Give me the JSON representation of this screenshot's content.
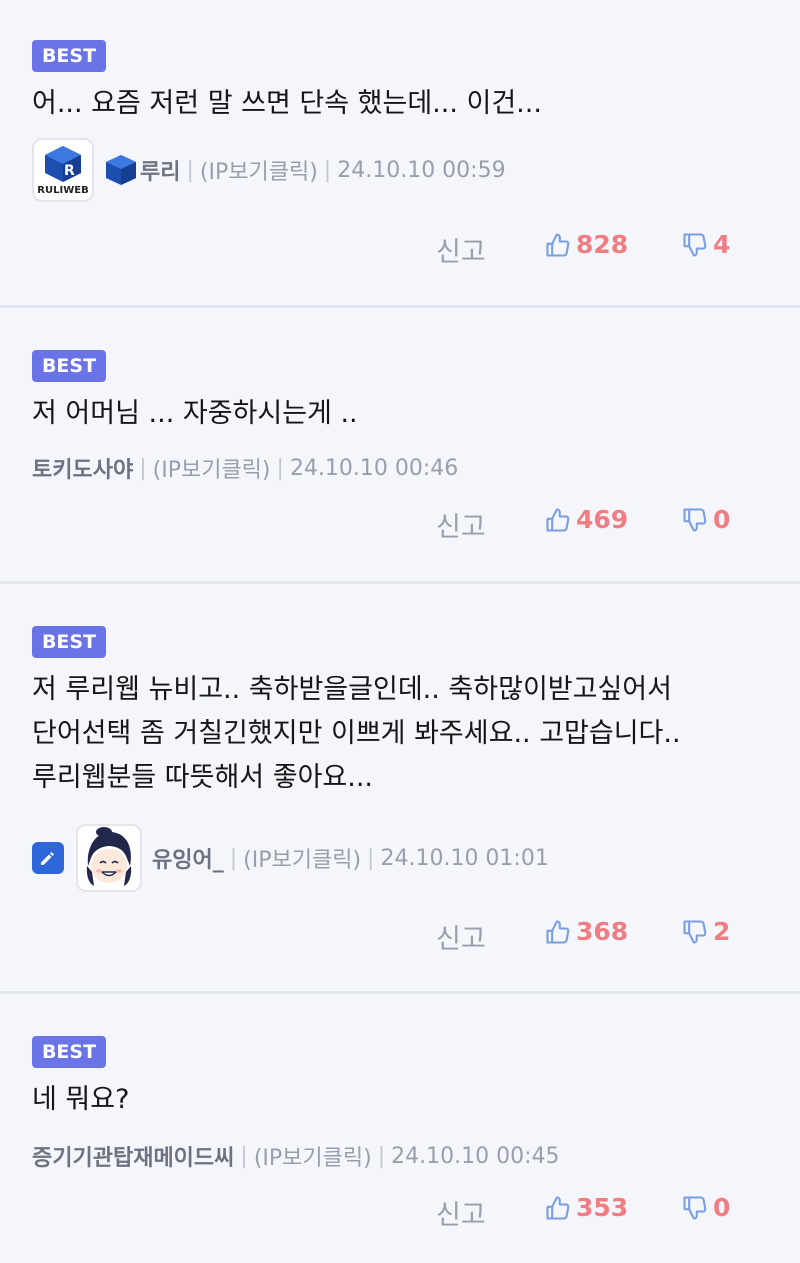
{
  "badge_label": "BEST",
  "report_label": "신고",
  "comments": [
    {
      "lines": [
        "어... 요즘 저런 말 쓰면 단속 했는데... 이건..."
      ],
      "avatar_text": "RULIWEB",
      "nickname": "루리",
      "ip": "(IP보기클릭)",
      "timestamp": "24.10.10 00:59",
      "likes": "828",
      "dislikes": "4"
    },
    {
      "lines": [
        "저 어머님 ... 자중하시는게 .."
      ],
      "nickname": "토키도사야",
      "ip": "(IP보기클릭)",
      "timestamp": "24.10.10 00:46",
      "likes": "469",
      "dislikes": "0"
    },
    {
      "lines": [
        "저 루리웹 뉴비고.. 축하받을글인데.. 축하많이받고싶어서",
        "단어선택 좀 거칠긴했지만 이쁘게 봐주세요.. 고맙습니다..",
        "루리웹분들 따뜻해서 좋아요..."
      ],
      "nickname": "유잉어_",
      "ip": "(IP보기클릭)",
      "timestamp": "24.10.10 01:01",
      "likes": "368",
      "dislikes": "2"
    },
    {
      "lines": [
        "네 뭐요?"
      ],
      "nickname": "증기기관탑재메이드씨",
      "ip": "(IP보기클릭)",
      "timestamp": "24.10.10 00:45",
      "likes": "353",
      "dislikes": "0"
    }
  ],
  "colors": {
    "badge": "#6a74e6",
    "count": "#ef7d82",
    "thumb": "#7a9fe0",
    "background": "#f4f6fb",
    "divider": "#e2e5ec"
  },
  "icons": [
    "ruliweb-logo-icon",
    "ruliweb-cube-icon",
    "edit-pencil-icon",
    "character-face-icon",
    "thumbs-up-icon",
    "thumbs-down-icon"
  ]
}
